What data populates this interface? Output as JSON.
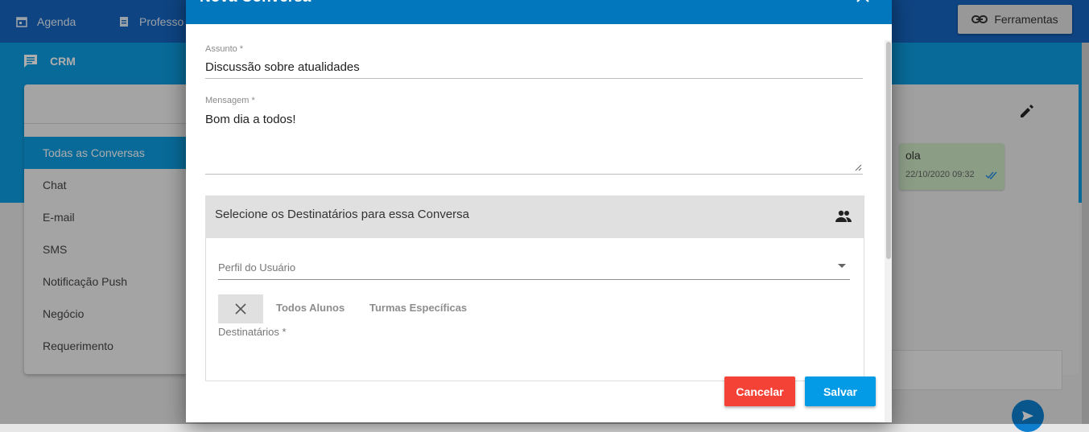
{
  "topnav": {
    "items": [
      {
        "label": "Agenda",
        "icon": "calendar-icon"
      },
      {
        "label": "Professo",
        "icon": "clipboard-icon"
      }
    ],
    "tools_button": {
      "label": "Ferramentas",
      "icon": "link-icon"
    }
  },
  "crm": {
    "title": "CRM",
    "icon": "chat-icon"
  },
  "sidebar": {
    "items": [
      {
        "label": "Todas as Conversas",
        "active": true
      },
      {
        "label": "Chat"
      },
      {
        "label": "E-mail"
      },
      {
        "label": "SMS"
      },
      {
        "label": "Notificação Push"
      },
      {
        "label": "Negócio"
      },
      {
        "label": "Requerimento"
      }
    ]
  },
  "chat": {
    "message": {
      "text": "ola",
      "time": "22/10/2020 09:32"
    },
    "edit_icon": "pencil-icon",
    "send_icon": "send-icon"
  },
  "dialog": {
    "title": "Nova Conversa",
    "close_icon": "close-icon",
    "subject": {
      "label": "Assunto *",
      "value": "Discussão sobre atualidades"
    },
    "message": {
      "label": "Mensagem *",
      "value": "Bom dia a todos!"
    },
    "recipients": {
      "title": "Selecione os Destinatários para essa Conversa",
      "icon": "people-icon",
      "profile_placeholder": "Perfil do Usuário",
      "toggle_options": [
        "Todos Alunos",
        "Turmas Específicas"
      ],
      "recipients_label": "Destinatários *"
    },
    "buttons": {
      "cancel": "Cancelar",
      "save": "Salvar"
    },
    "colors": {
      "header": "#0277bd",
      "cancel": "#f44336",
      "save": "#039be5"
    }
  }
}
